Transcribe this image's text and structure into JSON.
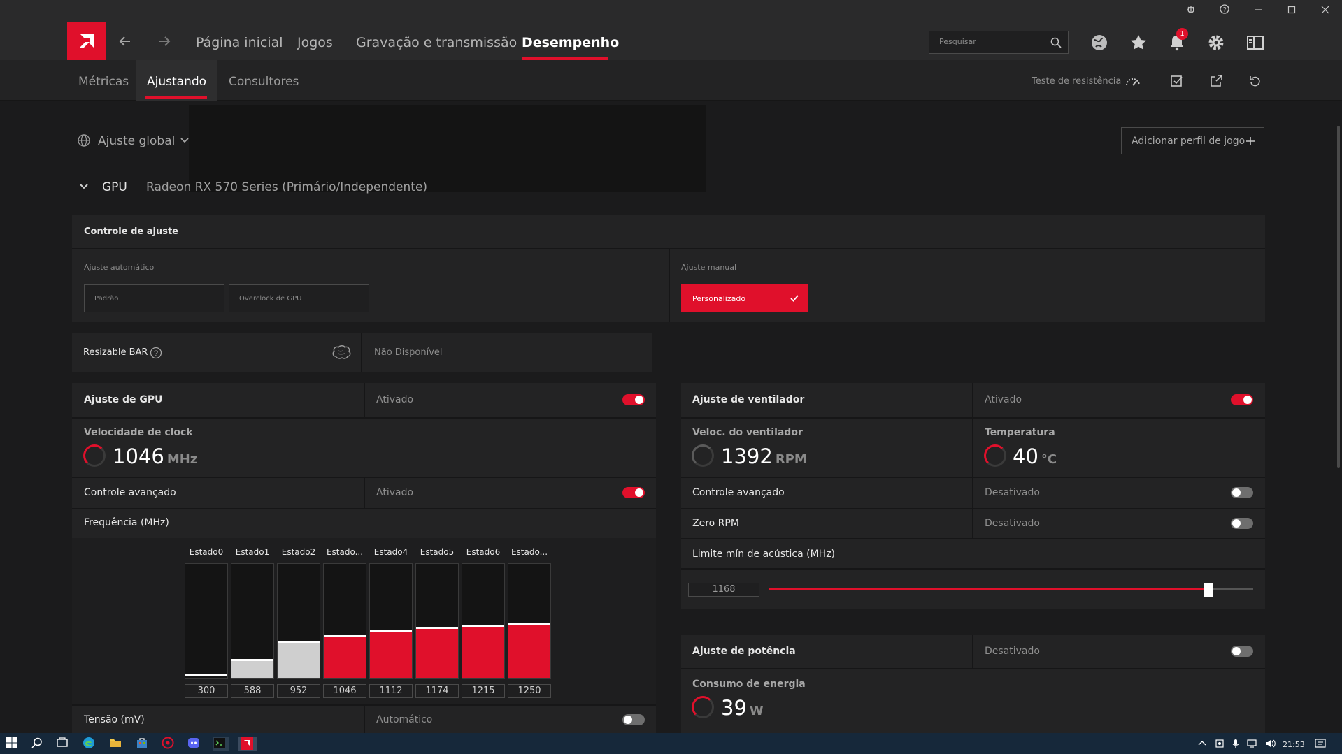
{
  "window": {
    "controls": [
      "bug-icon",
      "help-icon",
      "minimize-icon",
      "maximize-icon",
      "close-icon"
    ]
  },
  "nav": {
    "links": [
      "Página inicial",
      "Jogos",
      "Gravação e transmissão",
      "Desempenho"
    ],
    "active": "Desempenho",
    "search_placeholder": "Pesquisar",
    "notification_count": "1"
  },
  "subnav": {
    "tabs": [
      "Métricas",
      "Ajustando",
      "Consultores"
    ],
    "active": "Ajustando",
    "stress_test_label": "Teste de resistência"
  },
  "profile": {
    "global_label": "Ajuste global",
    "add_profile_label": "Adicionar perfil de jogo",
    "gpu_label": "GPU",
    "gpu_name": "Radeon RX 570 Series (Primário/Independente)"
  },
  "tuning_control": {
    "title": "Controle de ajuste",
    "auto_label": "Ajuste automático",
    "manual_label": "Ajuste manual",
    "preset_default": "Padrão",
    "preset_overclock": "Overclock de GPU",
    "custom_label": "Personalizado"
  },
  "resizable_bar": {
    "label": "Resizable BAR",
    "value": "Não Disponível"
  },
  "gpu_tuning": {
    "title": "Ajuste de GPU",
    "state": "Ativado",
    "enabled": true,
    "clock_label": "Velocidade de clock",
    "clock_value": "1046",
    "clock_unit": "MHz",
    "advanced_label": "Controle avançado",
    "advanced_state": "Ativado",
    "advanced_enabled": true,
    "frequency_label": "Frequência (MHz)",
    "voltage_label": "Tensão (mV)",
    "voltage_state": "Automático",
    "voltage_enabled": false
  },
  "frequency_states": {
    "labels": [
      "Estado0",
      "Estado1",
      "Estado2",
      "Estado...",
      "Estado4",
      "Estado5",
      "Estado6",
      "Estado..."
    ],
    "values": [
      300,
      588,
      952,
      1046,
      1112,
      1174,
      1215,
      1250
    ],
    "fill_fraction": [
      0.02,
      0.16,
      0.32,
      0.37,
      0.41,
      0.44,
      0.46,
      0.47
    ],
    "fill_color": [
      "#ffffff",
      "#cfcfcf",
      "#cfcfcf",
      "#e0102b",
      "#e0102b",
      "#e0102b",
      "#e0102b",
      "#e0102b"
    ]
  },
  "fan_tuning": {
    "title": "Ajuste de ventilador",
    "state": "Ativado",
    "enabled": true,
    "fan_speed_label": "Veloc. do ventilador",
    "fan_speed_value": "1392",
    "fan_speed_unit": "RPM",
    "temp_label": "Temperatura",
    "temp_value": "40",
    "temp_unit": "°C",
    "advanced_label": "Controle avançado",
    "advanced_state": "Desativado",
    "zero_rpm_label": "Zero RPM",
    "zero_rpm_state": "Desativado",
    "acoustic_label": "Limite mín de acústica (MHz)",
    "acoustic_value": "1168",
    "acoustic_fraction": 0.91
  },
  "power_tuning": {
    "title": "Ajuste de potência",
    "state": "Desativado",
    "consumption_label": "Consumo de energia",
    "consumption_value": "39",
    "consumption_unit": "W"
  },
  "taskbar": {
    "time": "21:53"
  },
  "colors": {
    "accent": "#e0102b",
    "background": "#1b1b1c",
    "panel": "#232324"
  }
}
